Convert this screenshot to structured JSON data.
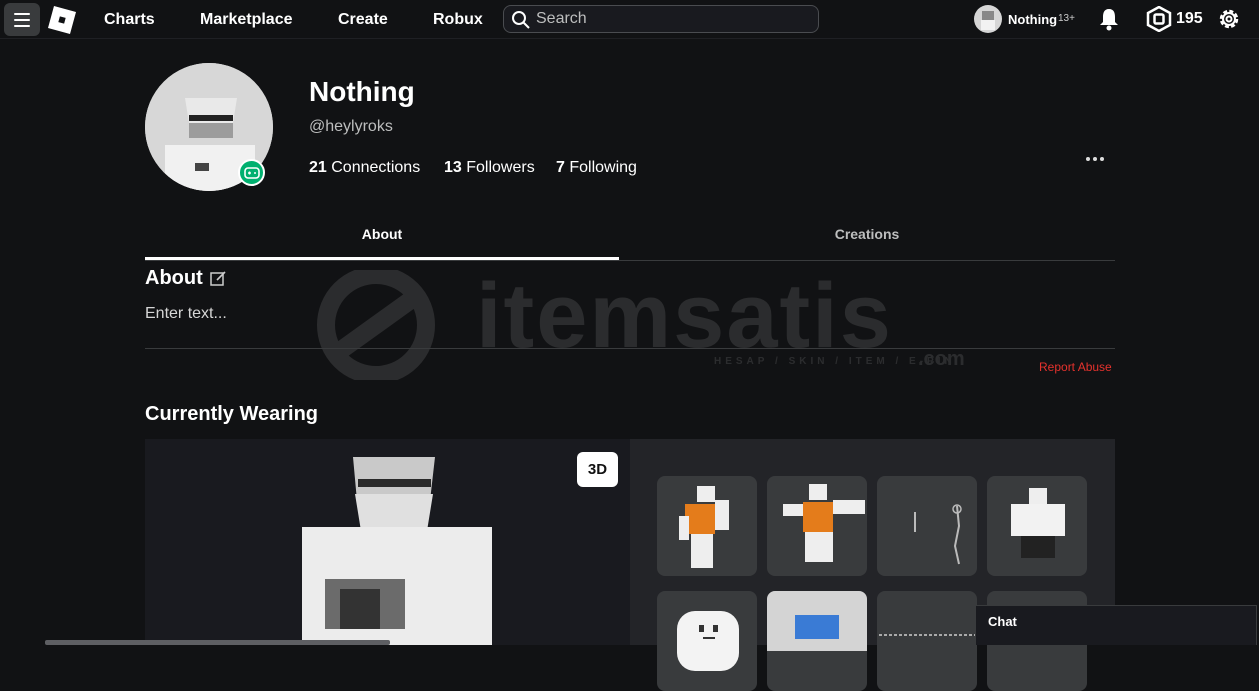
{
  "nav": {
    "links": [
      "Charts",
      "Marketplace",
      "Create",
      "Robux"
    ],
    "search_placeholder": "Search",
    "username": "Nothing",
    "age_badge": "13+",
    "robux": "195"
  },
  "profile": {
    "display_name": "Nothing",
    "handle": "@heylyroks",
    "stats": [
      {
        "count": "21",
        "label": "Connections"
      },
      {
        "count": "13",
        "label": "Followers"
      },
      {
        "count": "7",
        "label": "Following"
      }
    ]
  },
  "tabs": [
    "About",
    "Creations"
  ],
  "about": {
    "title": "About",
    "text": "Enter text...",
    "report_label": "Report Abuse"
  },
  "watermark": {
    "text": "itemsatis",
    "sub": "HESAP / SKIN / ITEM / E-PIN",
    "suffix": ".com"
  },
  "currently_wearing": {
    "title": "Currently Wearing",
    "view_toggle": "3D"
  },
  "chat": {
    "label": "Chat"
  },
  "colors": {
    "background": "#111214",
    "presence_green": "#00b06f",
    "report_red": "#e5322d",
    "card": "#393b3d"
  }
}
